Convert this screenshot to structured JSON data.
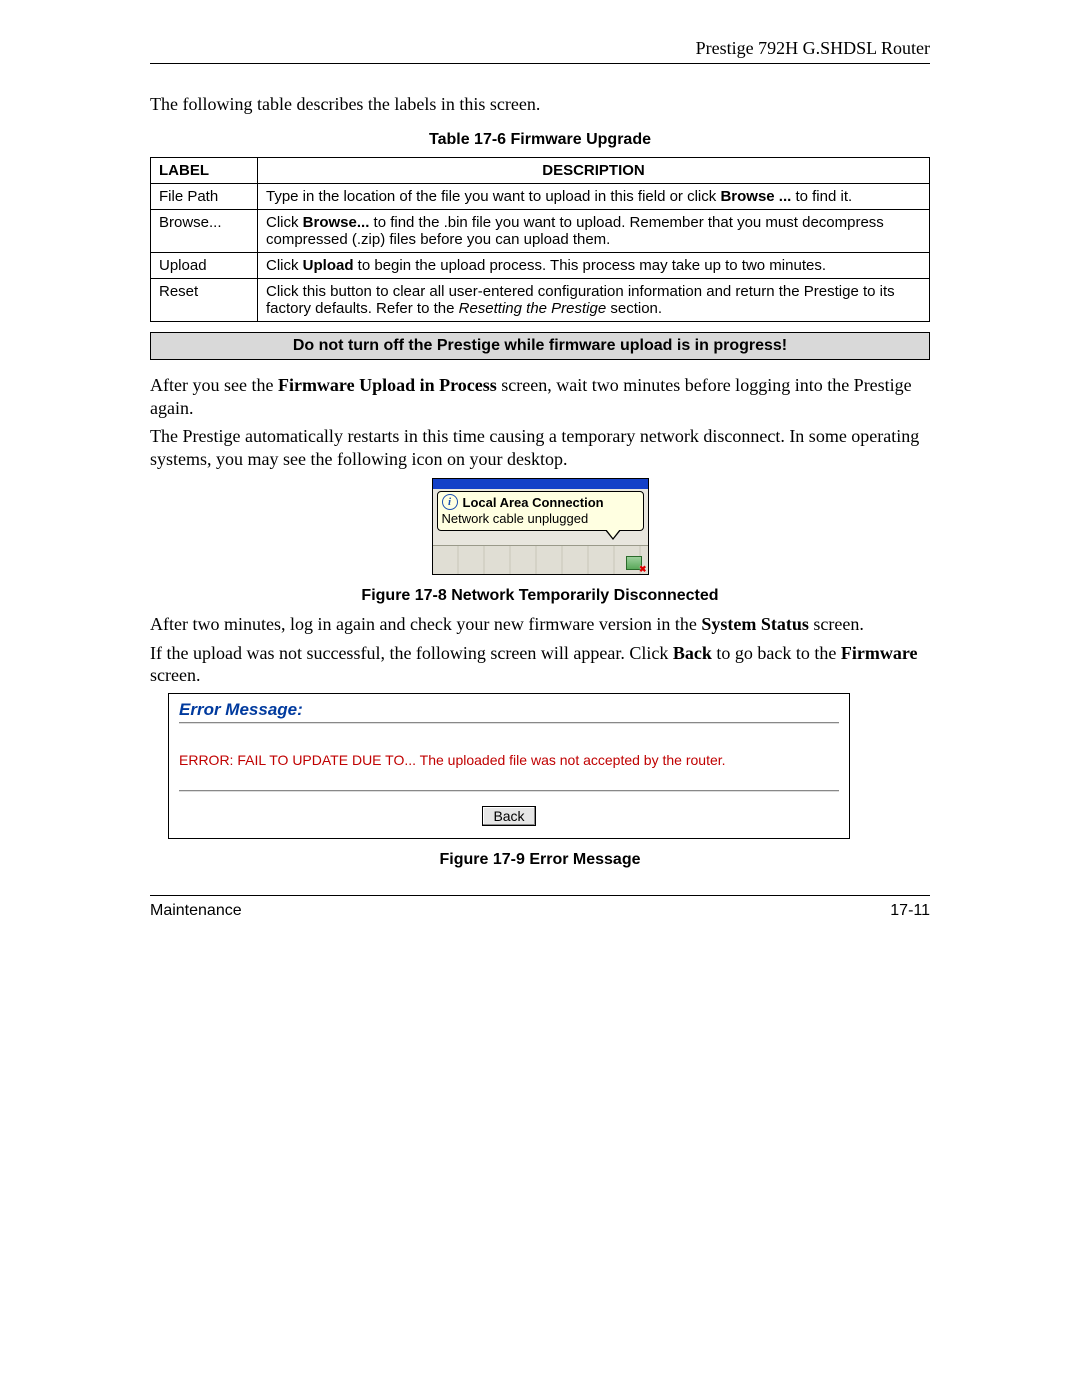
{
  "header": {
    "title": "Prestige 792H G.SHDSL Router"
  },
  "intro": "The following table describes the labels in this screen.",
  "table": {
    "caption": "Table 17-6 Firmware Upgrade",
    "head": {
      "label": "LABEL",
      "desc": "DESCRIPTION"
    },
    "rows": [
      {
        "label": "File Path",
        "pre": "Type in the location of the file you want to upload in this field or click ",
        "bold": "Browse ...",
        "post": " to find it."
      },
      {
        "label": "Browse...",
        "pre": "Click ",
        "bold": "Browse...",
        "post": " to find the .bin file you want to upload. Remember that you must decompress compressed (.zip) files before you can upload them."
      },
      {
        "label": "Upload",
        "pre": "Click ",
        "bold": "Upload",
        "post": " to begin the upload process. This process may take up to two minutes."
      },
      {
        "label": "Reset",
        "pre": "Click this button to clear all user-entered configuration information and return the Prestige to its factory defaults. Refer to the ",
        "italic": "Resetting the Prestige",
        "post": " section."
      }
    ]
  },
  "warning": "Do not turn off the Prestige while firmware upload is in progress!",
  "p1": {
    "pre": "After you see the ",
    "bold": "Firmware Upload in Process",
    "post": " screen, wait two minutes before logging into the Prestige again."
  },
  "p2": "The Prestige automatically restarts in this time causing a temporary network disconnect. In some operating systems, you may see the following icon on your desktop.",
  "netfig": {
    "title": "Local Area Connection",
    "sub": "Network cable unplugged",
    "caption": "Figure 17-8 Network Temporarily Disconnected"
  },
  "p3": {
    "pre": "After two minutes, log in again and check your new firmware version in the ",
    "bold": "System Status",
    "post": " screen."
  },
  "p4": {
    "pre": "If the upload was not successful, the following screen will appear.  Click ",
    "bold1": "Back",
    "mid": " to go back to the ",
    "bold2": "Firmware",
    "post": " screen."
  },
  "errfig": {
    "heading": "Error Message:",
    "text": "ERROR: FAIL TO UPDATE DUE TO... The uploaded file was not accepted by the router.",
    "button": "Back",
    "caption": "Figure 17-9 Error Message"
  },
  "footer": {
    "left": "Maintenance",
    "right": "17-11"
  }
}
